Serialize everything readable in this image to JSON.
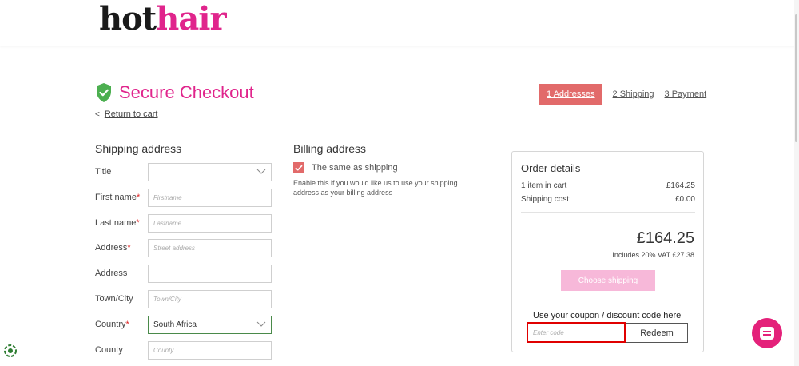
{
  "header": {
    "logo_hot": "hot",
    "logo_hair": "hair"
  },
  "checkout": {
    "title": "Secure Checkout",
    "return_link": "Return to cart",
    "steps": [
      "1 Addresses",
      "2 Shipping",
      "3 Payment"
    ],
    "active_step": 0
  },
  "shipping": {
    "heading": "Shipping address",
    "fields": [
      {
        "label": "Title",
        "required": false,
        "type": "select",
        "value": "",
        "placeholder": ""
      },
      {
        "label": "First name",
        "required": true,
        "type": "input",
        "value": "",
        "placeholder": "Firstname"
      },
      {
        "label": "Last name",
        "required": true,
        "type": "input",
        "value": "",
        "placeholder": "Lastname"
      },
      {
        "label": "Address",
        "required": true,
        "type": "input",
        "value": "",
        "placeholder": "Street address"
      },
      {
        "label": "Address",
        "required": false,
        "type": "input",
        "value": "",
        "placeholder": ""
      },
      {
        "label": "Town/City",
        "required": false,
        "type": "input",
        "value": "",
        "placeholder": "Town/City"
      },
      {
        "label": "Country",
        "required": true,
        "type": "select",
        "value": "South Africa",
        "placeholder": ""
      },
      {
        "label": "County",
        "required": false,
        "type": "input",
        "value": "",
        "placeholder": "County"
      }
    ],
    "required_mark": "*"
  },
  "billing": {
    "heading": "Billing address",
    "same_as_shipping_label": "The same as shipping",
    "same_as_shipping_checked": true,
    "note": "Enable this if you would like us to use your shipping address as your billing address"
  },
  "order": {
    "title": "Order details",
    "items_label": "1 item in cart",
    "items_value": "£164.25",
    "shipping_label": "Shipping cost:",
    "shipping_value": "£0.00",
    "total": "£164.25",
    "vat_note": "Includes 20% VAT £27.38",
    "choose_shipping_label": "Choose shipping",
    "coupon_label": "Use your coupon / discount code here",
    "coupon_placeholder": "Enter code",
    "redeem_label": "Redeem"
  },
  "colors": {
    "brand_pink": "#e0258c",
    "step_active": "#e26a6a",
    "choose_shipping": "#f7b8d9",
    "chat": "#e4217a",
    "shield_green": "#4caf50"
  },
  "icons": [
    "shield-check-icon",
    "chevron-left-icon",
    "chevron-down-icon",
    "checkmark-icon",
    "chat-icon",
    "accessibility-icon"
  ]
}
